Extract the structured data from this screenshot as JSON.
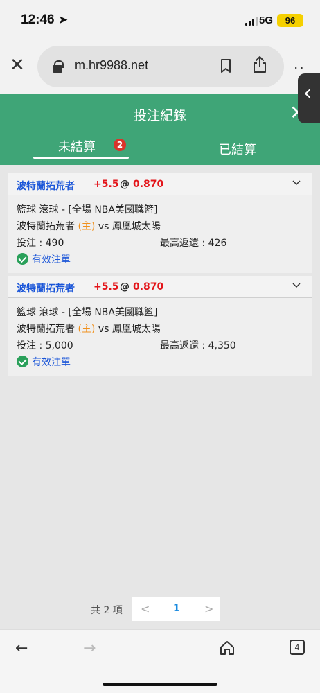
{
  "status_bar": {
    "time": "12:46",
    "network": "5G",
    "battery": "96"
  },
  "browser": {
    "url": "m.hr9988.net"
  },
  "header": {
    "title": "投注紀錄"
  },
  "tabs": [
    {
      "label": "未結算",
      "badge": "2"
    },
    {
      "label": "已結算"
    }
  ],
  "bets": [
    {
      "team": "波特蘭拓荒者",
      "handicap": "+5.5",
      "at": "@",
      "odds": "0.870",
      "sport_line": "籃球 滾球 - [全場 NBA美國職籃]",
      "home_team": "波特蘭拓荒者",
      "home_tag": "(主)",
      "vs": "vs",
      "away_team": "鳳凰城太陽",
      "stake_label": "投注 : ",
      "stake": "490",
      "max_return_label": "最高返還 : ",
      "max_return": "426",
      "status": "有效注單"
    },
    {
      "team": "波特蘭拓荒者",
      "handicap": "+5.5",
      "at": "@",
      "odds": "0.870",
      "sport_line": "籃球 滾球 - [全場 NBA美國職籃]",
      "home_team": "波特蘭拓荒者",
      "home_tag": "(主)",
      "vs": "vs",
      "away_team": "鳳凰城太陽",
      "stake_label": "投注 : ",
      "stake": "5,000",
      "max_return_label": "最高返還 : ",
      "max_return": "4,350",
      "status": "有效注單"
    }
  ],
  "pagination": {
    "total": "共 2 項",
    "current_page": "1",
    "prev": "<",
    "next": ">"
  },
  "toolbar": {
    "tab_count": "4"
  }
}
